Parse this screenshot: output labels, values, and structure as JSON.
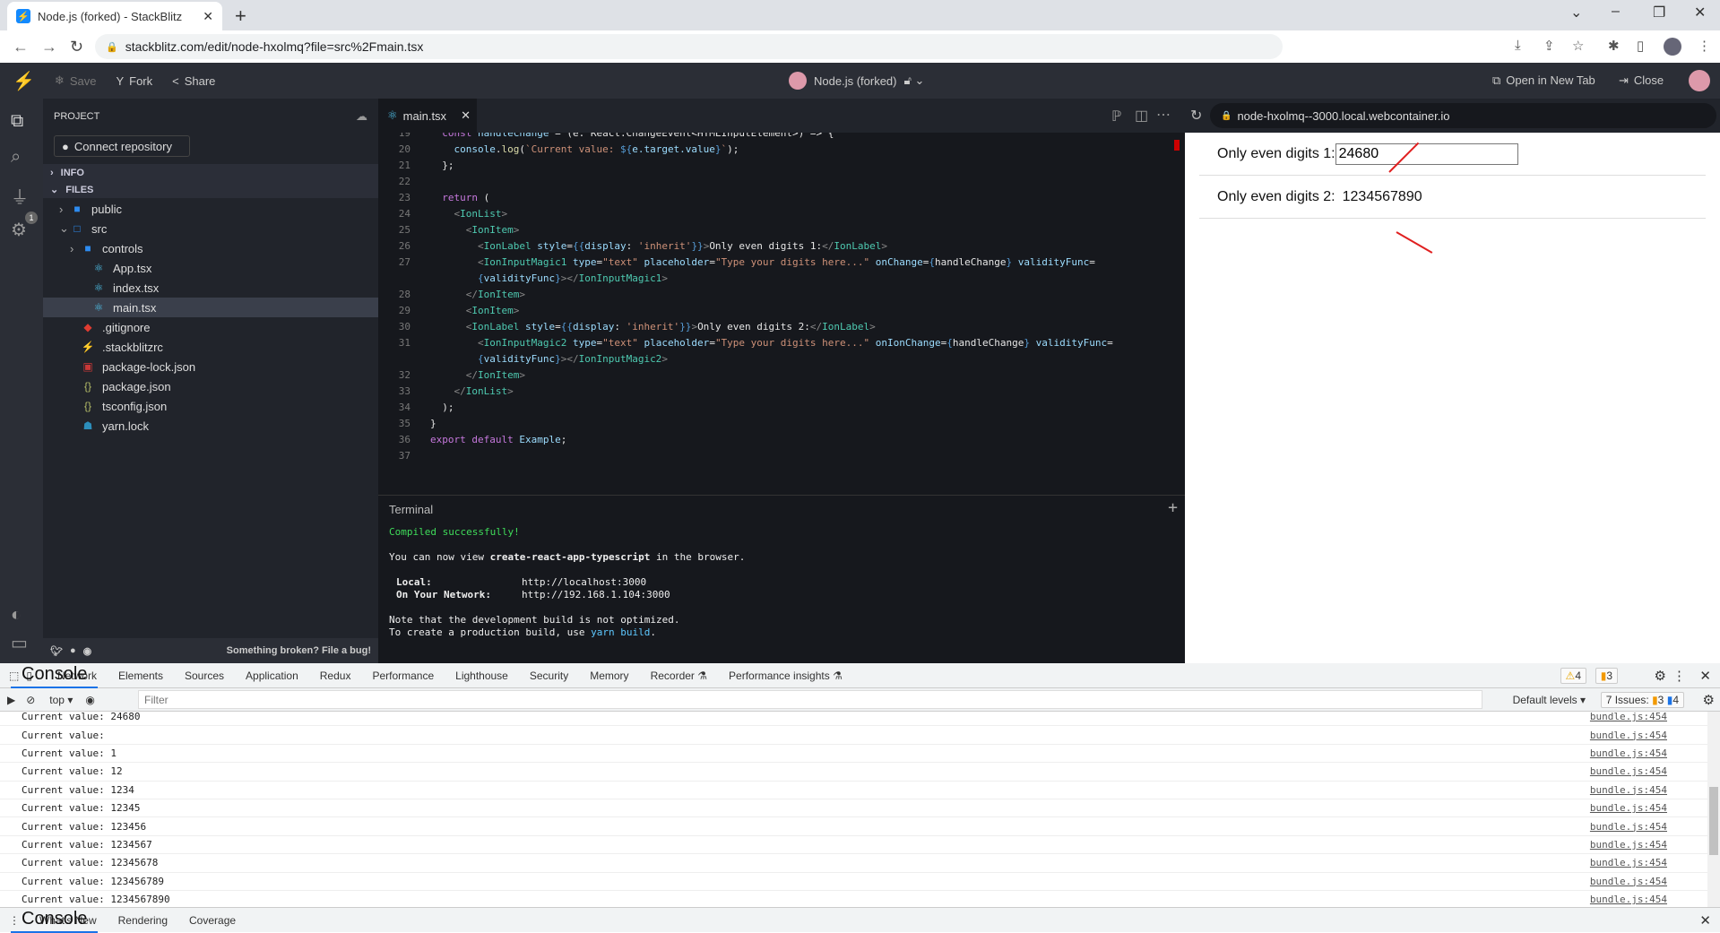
{
  "browser": {
    "tab_title": "Node.js (forked) - StackBlitz",
    "url": "stackblitz.com/edit/node-hxolmq?file=src%2Fmain.tsx"
  },
  "header": {
    "save": "Save",
    "fork": "Fork",
    "share": "Share",
    "project_name": "Node.js (forked)",
    "open_new_tab": "Open in New Tab",
    "close": "Close"
  },
  "sidebar": {
    "title": "PROJECT",
    "connect": "Connect repository",
    "info": "INFO",
    "files": "FILES",
    "footer": "Something broken? File a bug!",
    "plugin_badge": "1",
    "items": [
      {
        "label": "public",
        "icon": "folder",
        "depth": 1,
        "chev": "›"
      },
      {
        "label": "src",
        "icon": "folder-open",
        "depth": 1,
        "chev": "⌄"
      },
      {
        "label": "controls",
        "icon": "folder",
        "depth": 2,
        "chev": "›"
      },
      {
        "label": "App.tsx",
        "icon": "react",
        "depth": 3,
        "chev": ""
      },
      {
        "label": "index.tsx",
        "icon": "react",
        "depth": 3,
        "chev": ""
      },
      {
        "label": "main.tsx",
        "icon": "react",
        "depth": 3,
        "chev": "",
        "selected": true
      },
      {
        "label": ".gitignore",
        "icon": "git",
        "depth": 2,
        "chev": ""
      },
      {
        "label": ".stackblitzrc",
        "icon": "bolt",
        "depth": 2,
        "chev": ""
      },
      {
        "label": "package-lock.json",
        "icon": "npm",
        "depth": 2,
        "chev": ""
      },
      {
        "label": "package.json",
        "icon": "json",
        "depth": 2,
        "chev": ""
      },
      {
        "label": "tsconfig.json",
        "icon": "json",
        "depth": 2,
        "chev": ""
      },
      {
        "label": "yarn.lock",
        "icon": "yarn",
        "depth": 2,
        "chev": ""
      }
    ]
  },
  "editor": {
    "tab": "main.tsx",
    "lines": [
      {
        "n": "19",
        "t": [
          [
            "kw",
            "  const "
          ],
          [
            "attr",
            "handleChange"
          ],
          [
            "txt",
            " = (e: React.ChangeEvent<HTMLInputElement>) => {"
          ]
        ]
      },
      {
        "n": "20",
        "t": [
          [
            "attr",
            "    console"
          ],
          [
            "txt",
            "."
          ],
          [
            "fn",
            "log"
          ],
          [
            "txt",
            "("
          ],
          [
            "str",
            "`Current value: "
          ],
          [
            "br",
            "${"
          ],
          [
            "attr",
            "e.target.value"
          ],
          [
            "br",
            "}"
          ],
          [
            "str",
            "`"
          ],
          [
            "txt",
            ");"
          ]
        ]
      },
      {
        "n": "21",
        "t": [
          [
            "txt",
            "  };"
          ]
        ]
      },
      {
        "n": "22",
        "t": []
      },
      {
        "n": "23",
        "t": [
          [
            "kw",
            "  return"
          ],
          [
            "txt",
            " ("
          ]
        ]
      },
      {
        "n": "24",
        "t": [
          [
            "punc",
            "    <"
          ],
          [
            "tag",
            "IonList"
          ],
          [
            "punc",
            ">"
          ]
        ]
      },
      {
        "n": "25",
        "t": [
          [
            "punc",
            "      <"
          ],
          [
            "tag",
            "IonItem"
          ],
          [
            "punc",
            ">"
          ]
        ]
      },
      {
        "n": "26",
        "t": [
          [
            "punc",
            "        <"
          ],
          [
            "tag",
            "IonLabel"
          ],
          [
            "attr",
            " style"
          ],
          [
            "txt",
            "="
          ],
          [
            "br",
            "{{"
          ],
          [
            "attr",
            "display"
          ],
          [
            "txt",
            ": "
          ],
          [
            "str",
            "'inherit'"
          ],
          [
            "br",
            "}}"
          ],
          [
            "punc",
            ">"
          ],
          [
            "txt",
            "Only even digits 1:"
          ],
          [
            "punc",
            "</"
          ],
          [
            "tag",
            "IonLabel"
          ],
          [
            "punc",
            ">"
          ]
        ]
      },
      {
        "n": "27",
        "t": [
          [
            "punc",
            "        <"
          ],
          [
            "tag",
            "IonInputMagic1"
          ],
          [
            "attr",
            " type"
          ],
          [
            "txt",
            "="
          ],
          [
            "str",
            "\"text\""
          ],
          [
            "attr",
            " placeholder"
          ],
          [
            "txt",
            "="
          ],
          [
            "str",
            "\"Type your digits here...\""
          ],
          [
            "attr",
            " onChange"
          ],
          [
            "txt",
            "="
          ],
          [
            "br",
            "{"
          ],
          [
            "txt",
            "handleChange"
          ],
          [
            "br",
            "}"
          ],
          [
            "attr",
            " validityFunc"
          ],
          [
            "txt",
            "="
          ]
        ]
      },
      {
        "n": "",
        "t": [
          [
            "br",
            "        {"
          ],
          [
            "attr",
            "validityFunc"
          ],
          [
            "br",
            "}"
          ],
          [
            "punc",
            "></"
          ],
          [
            "tag",
            "IonInputMagic1"
          ],
          [
            "punc",
            ">"
          ]
        ]
      },
      {
        "n": "28",
        "t": [
          [
            "punc",
            "      </"
          ],
          [
            "tag",
            "IonItem"
          ],
          [
            "punc",
            ">"
          ]
        ]
      },
      {
        "n": "29",
        "t": [
          [
            "punc",
            "      <"
          ],
          [
            "tag",
            "IonItem"
          ],
          [
            "punc",
            ">"
          ]
        ]
      },
      {
        "n": "30",
        "t": [
          [
            "punc",
            "      <"
          ],
          [
            "tag",
            "IonLabel"
          ],
          [
            "attr",
            " style"
          ],
          [
            "txt",
            "="
          ],
          [
            "br",
            "{{"
          ],
          [
            "attr",
            "display"
          ],
          [
            "txt",
            ": "
          ],
          [
            "str",
            "'inherit'"
          ],
          [
            "br",
            "}}"
          ],
          [
            "punc",
            ">"
          ],
          [
            "txt",
            "Only even digits 2:"
          ],
          [
            "punc",
            "</"
          ],
          [
            "tag",
            "IonLabel"
          ],
          [
            "punc",
            ">"
          ]
        ]
      },
      {
        "n": "31",
        "t": [
          [
            "punc",
            "        <"
          ],
          [
            "tag",
            "IonInputMagic2"
          ],
          [
            "attr",
            " type"
          ],
          [
            "txt",
            "="
          ],
          [
            "str",
            "\"text\""
          ],
          [
            "attr",
            " placeholder"
          ],
          [
            "txt",
            "="
          ],
          [
            "str",
            "\"Type your digits here...\""
          ],
          [
            "attr",
            " onIonChange"
          ],
          [
            "txt",
            "="
          ],
          [
            "br",
            "{"
          ],
          [
            "txt",
            "handleChange"
          ],
          [
            "br",
            "}"
          ],
          [
            "attr",
            " validityFunc"
          ],
          [
            "txt",
            "="
          ]
        ]
      },
      {
        "n": "",
        "t": [
          [
            "br",
            "        {"
          ],
          [
            "attr",
            "validityFunc"
          ],
          [
            "br",
            "}"
          ],
          [
            "punc",
            "></"
          ],
          [
            "tag",
            "IonInputMagic2"
          ],
          [
            "punc",
            ">"
          ]
        ]
      },
      {
        "n": "32",
        "t": [
          [
            "punc",
            "      </"
          ],
          [
            "tag",
            "IonItem"
          ],
          [
            "punc",
            ">"
          ]
        ]
      },
      {
        "n": "33",
        "t": [
          [
            "punc",
            "    </"
          ],
          [
            "tag",
            "IonList"
          ],
          [
            "punc",
            ">"
          ]
        ]
      },
      {
        "n": "34",
        "t": [
          [
            "txt",
            "  );"
          ]
        ]
      },
      {
        "n": "35",
        "t": [
          [
            "txt",
            "}"
          ]
        ]
      },
      {
        "n": "36",
        "t": [
          [
            "kw",
            "export default "
          ],
          [
            "attr",
            "Example"
          ],
          [
            "txt",
            ";"
          ]
        ]
      },
      {
        "n": "37",
        "t": []
      }
    ]
  },
  "terminal": {
    "title": "Terminal",
    "compiled": "Compiled successfully!",
    "view_pre": "You can now view ",
    "app": "create-react-app-typescript",
    "view_post": " in the browser.",
    "local_label": "Local:",
    "local_url": "http://localhost:3000",
    "net_label": "On Your Network:",
    "net_url": "http://192.168.1.104:3000",
    "note": "Note that the development build is not optimized.",
    "prod_pre": "To create a production build, use ",
    "prod_cmd": "yarn build",
    "prod_post": "."
  },
  "preview": {
    "url": "node-hxolmq--3000.local.webcontainer.io",
    "label1": "Only even digits 1:",
    "value1": "24680",
    "label2": "Only even digits 2:",
    "value2": "1234567890"
  },
  "devtools": {
    "tabs": [
      "Network",
      "Elements",
      "Console",
      "Sources",
      "Application",
      "Redux",
      "Performance",
      "Lighthouse",
      "Security",
      "Memory",
      "Recorder ⚗",
      "Performance insights ⚗"
    ],
    "active_tab": "Console",
    "warnings": "4",
    "errors": "3",
    "context": "top",
    "filter_placeholder": "Filter",
    "levels": "Default levels",
    "issues_label": "7 Issues:",
    "issues_err": "3",
    "issues_info": "4",
    "logs": [
      "Current value: 24680",
      "Current value: ",
      "Current value: 1",
      "Current value: 12",
      "Current value: 1234",
      "Current value: 12345",
      "Current value: 123456",
      "Current value: 1234567",
      "Current value: 12345678",
      "Current value: 123456789",
      "Current value: 1234567890"
    ],
    "log_source": "bundle.js:454",
    "drawer_tabs": [
      "Console",
      "What's New",
      "Rendering",
      "Coverage"
    ]
  }
}
